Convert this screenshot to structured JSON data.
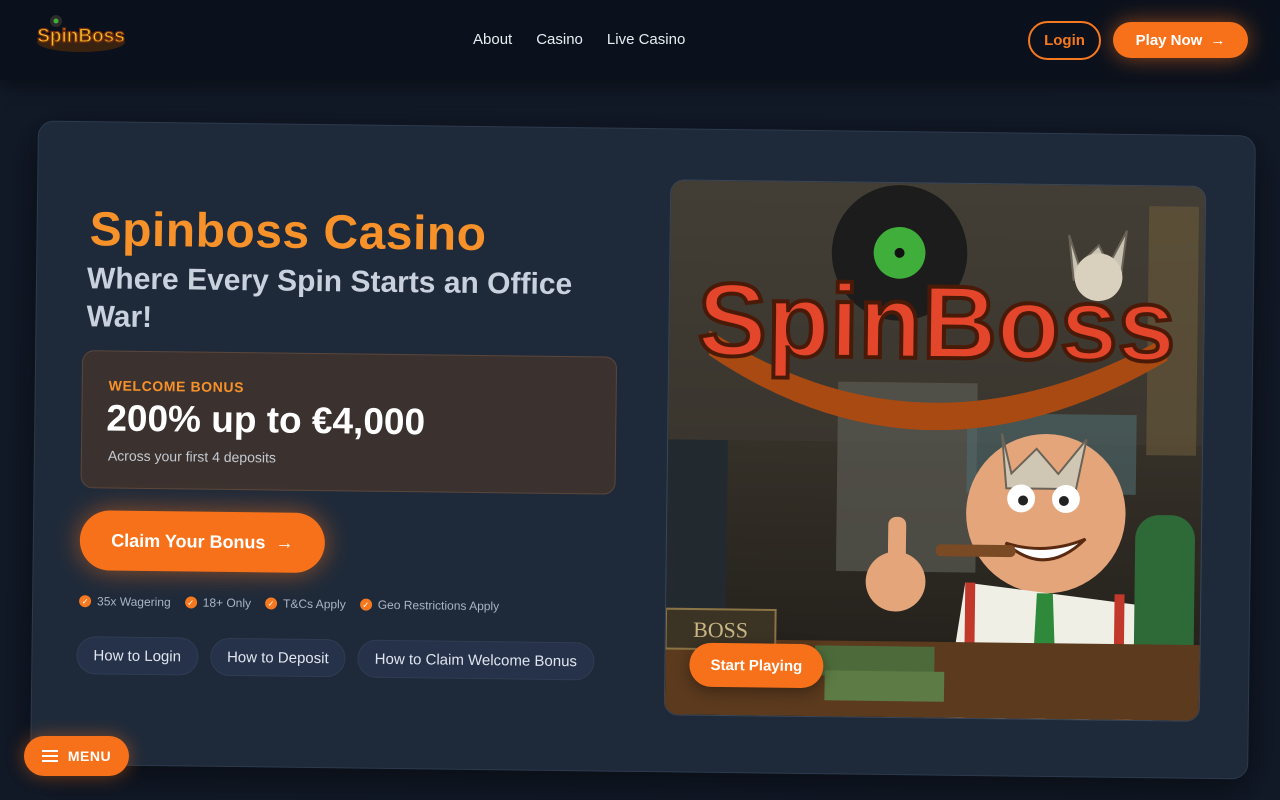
{
  "brand": {
    "logo_text": "SpinBoss"
  },
  "nav": {
    "items": [
      "About",
      "Casino",
      "Live Casino"
    ]
  },
  "header": {
    "login_label": "Login",
    "play_label": "Play Now",
    "arrow": "→"
  },
  "hero": {
    "title": "Spinboss Casino",
    "subtitle": "Where Every Spin Starts an Office War!",
    "bonus": {
      "label": "WELCOME BONUS",
      "amount": "200% up to €4,000",
      "note": "Across your first 4 deposits"
    },
    "claim_label": "Claim Your Bonus",
    "badges": [
      "35x Wagering",
      "18+ Only",
      "T&Cs Apply",
      "Geo Restrictions Apply"
    ],
    "guides": [
      "How to Login",
      "How to Deposit",
      "How to Claim Welcome Bonus"
    ],
    "promo": {
      "logo_text": "SpinBoss",
      "sign_text": "BOSS",
      "start_label": "Start Playing"
    }
  },
  "menu_label": "MENU",
  "colors": {
    "accent": "#f7711a",
    "title": "#f7912a",
    "background": "#121a28",
    "card": "#1e2a3a"
  }
}
